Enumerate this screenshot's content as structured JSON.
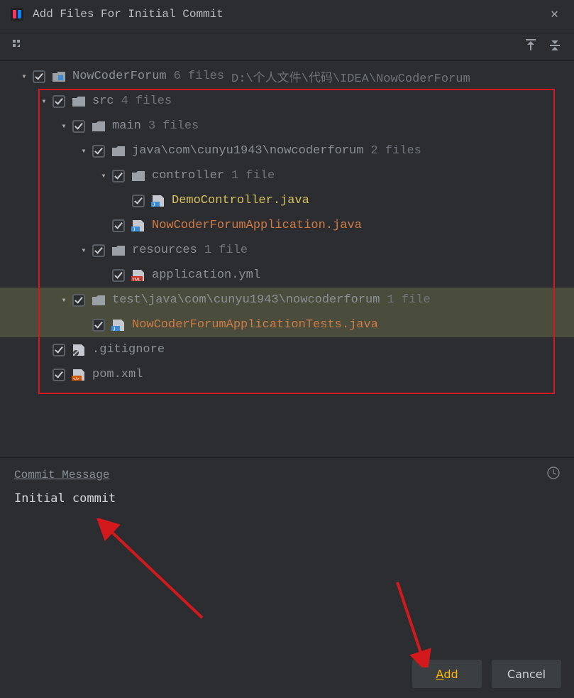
{
  "title": "Add Files For Initial Commit",
  "tree": {
    "root": {
      "name": "NowCoderForum",
      "files_label": "6 files",
      "path": "D:\\个人文件\\代码\\IDEA\\NowCoderForum"
    },
    "rows": [
      {
        "indent": 1,
        "chev": true,
        "name": "src",
        "extra": "4 files",
        "icon": "folder",
        "color": "gray"
      },
      {
        "indent": 2,
        "chev": true,
        "name": "main",
        "extra": "3 files",
        "icon": "folder",
        "color": "gray"
      },
      {
        "indent": 3,
        "chev": true,
        "name": "java\\com\\cunyu1943\\nowcoderforum",
        "extra": "2 files",
        "icon": "folder",
        "color": "gray"
      },
      {
        "indent": 4,
        "chev": true,
        "name": "controller",
        "extra": "1 file",
        "icon": "folder",
        "color": "gray"
      },
      {
        "indent": 5,
        "chev": false,
        "name": "DemoController.java",
        "extra": "",
        "icon": "java",
        "color": "yellow"
      },
      {
        "indent": 4,
        "chev": false,
        "name": "NowCoderForumApplication.java",
        "extra": "",
        "icon": "java",
        "color": "orange"
      },
      {
        "indent": 3,
        "chev": true,
        "name": "resources",
        "extra": "1 file",
        "icon": "folder",
        "color": "gray"
      },
      {
        "indent": 4,
        "chev": false,
        "name": "application.yml",
        "extra": "",
        "icon": "yml",
        "color": "gray"
      },
      {
        "indent": 2,
        "chev": true,
        "name": "test\\java\\com\\cunyu1943\\nowcoderforum",
        "extra": "1 file",
        "icon": "folder",
        "color": "gray",
        "selected": true
      },
      {
        "indent": 3,
        "chev": false,
        "name": "NowCoderForumApplicationTests.java",
        "extra": "",
        "icon": "java",
        "color": "orange",
        "selected": true
      },
      {
        "indent": 1,
        "chev": false,
        "name": ".gitignore",
        "extra": "",
        "icon": "gitignore",
        "color": "gray"
      },
      {
        "indent": 1,
        "chev": false,
        "name": "pom.xml",
        "extra": "",
        "icon": "pom",
        "color": "gray"
      }
    ]
  },
  "commit": {
    "header": "Commit Message",
    "value": "Initial commit"
  },
  "buttons": {
    "add_p": "A",
    "add_s": "dd",
    "cancel": "Cancel"
  }
}
